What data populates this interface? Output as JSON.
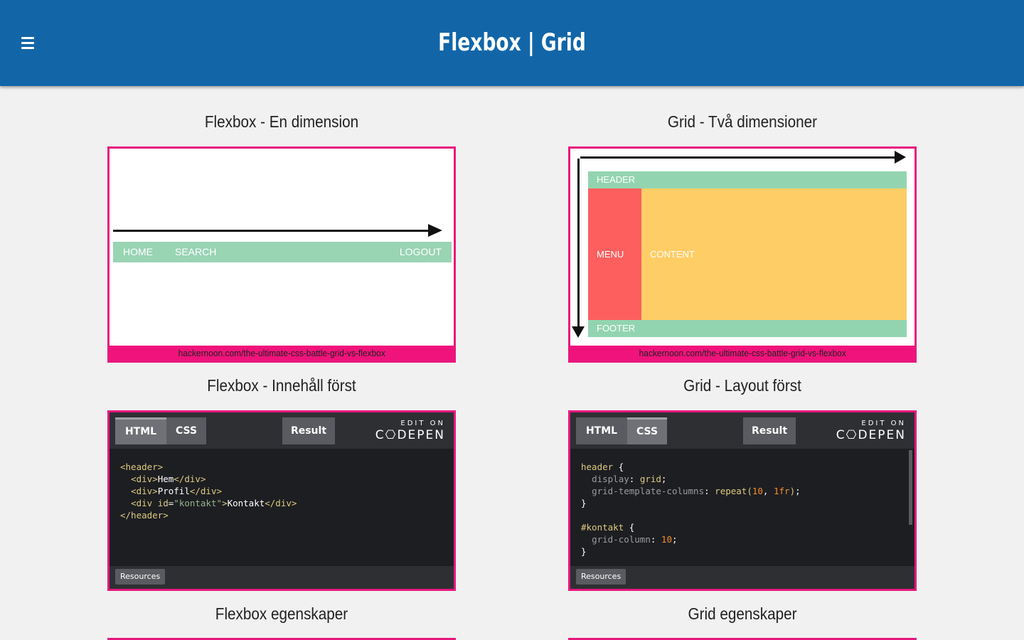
{
  "header": {
    "title": "Flexbox | Grid",
    "menu_icon": "hamburger-icon"
  },
  "sections": {
    "flex_dimension": {
      "title": "Flexbox - En dimension",
      "nav_items": [
        "HOME",
        "SEARCH",
        "LOGOUT"
      ],
      "caption": "hackernoon.com/the-ultimate-css-battle-grid-vs-flexbox"
    },
    "grid_dimension": {
      "title": "Grid - Två dimensioner",
      "labels": {
        "header": "HEADER",
        "menu": "MENU",
        "content": "CONTENT",
        "footer": "FOOTER"
      },
      "caption": "hackernoon.com/the-ultimate-css-battle-grid-vs-flexbox"
    },
    "flex_content": {
      "title": "Flexbox - Innehåll först"
    },
    "grid_layout": {
      "title": "Grid - Layout först"
    },
    "flex_props": {
      "title": "Flexbox egenskaper"
    },
    "grid_props": {
      "title": "Grid egenskaper"
    }
  },
  "codepen": {
    "tab_html": "HTML",
    "tab_css": "CSS",
    "tab_result": "Result",
    "edit_on": "EDIT ON",
    "brand": "C⎔DEPEN",
    "resources": "Resources"
  },
  "colors": {
    "topbar": "#1266a8",
    "accent": "#e6187e",
    "caption": "#f0137b"
  }
}
